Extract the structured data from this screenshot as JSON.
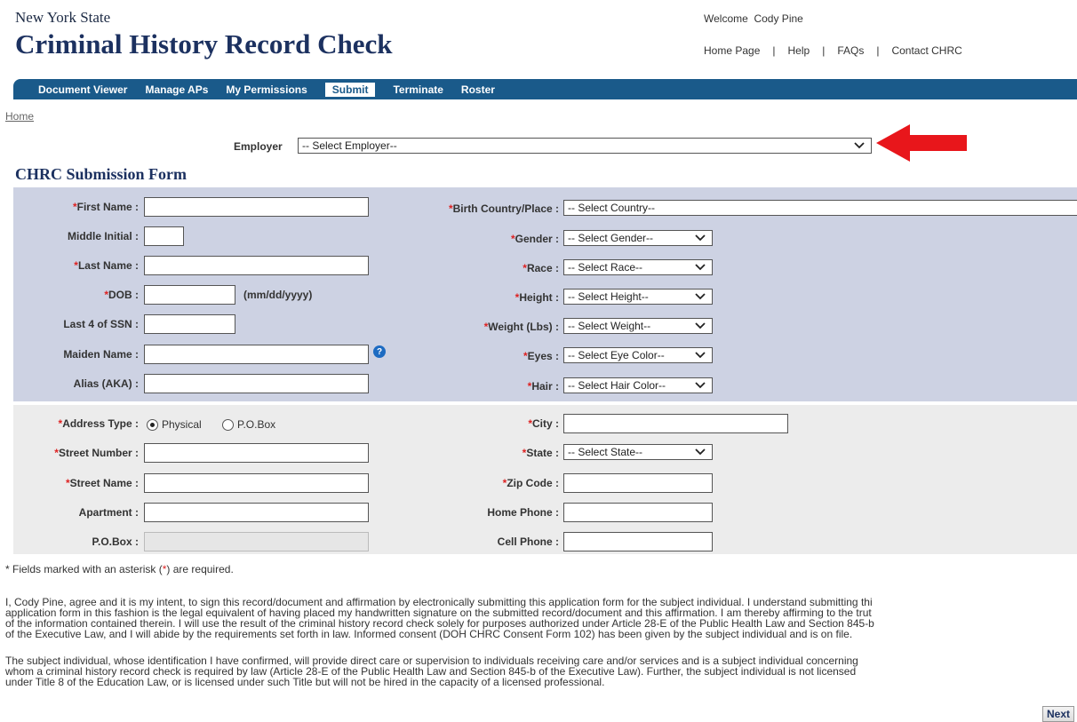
{
  "header": {
    "subtitle": "New York State",
    "title": "Criminal History Record Check",
    "welcome": "Welcome  Cody Pine",
    "links": [
      "Home Page",
      "Help",
      "FAQs",
      "Contact CHRC"
    ]
  },
  "nav": {
    "items": [
      {
        "label": "Document Viewer",
        "active": false
      },
      {
        "label": "Manage APs",
        "active": false
      },
      {
        "label": "My Permissions",
        "active": false
      },
      {
        "label": "Submit",
        "active": true
      },
      {
        "label": "Terminate",
        "active": false
      },
      {
        "label": "Roster",
        "active": false
      }
    ]
  },
  "breadcrumb": "Home",
  "employer": {
    "label": "Employer",
    "value": "-- Select Employer--"
  },
  "form_title": "CHRC Submission Form",
  "personal": {
    "first_name": "First Name :",
    "middle_initial": "Middle Initial :",
    "last_name": "Last Name :",
    "dob": "DOB :",
    "dob_hint": "(mm/dd/yyyy)",
    "ssn": "Last 4 of SSN :",
    "maiden": "Maiden Name :",
    "alias": "Alias (AKA) :",
    "birth_country": "Birth Country/Place :",
    "birth_country_value": "-- Select Country--",
    "gender": "Gender :",
    "gender_value": "-- Select Gender--",
    "race": "Race :",
    "race_value": "-- Select Race--",
    "height": "Height :",
    "height_value": "-- Select Height--",
    "weight": "Weight (Lbs) :",
    "weight_value": "-- Select Weight--",
    "eyes": "Eyes :",
    "eyes_value": "-- Select Eye Color--",
    "hair": "Hair :",
    "hair_value": "-- Select Hair Color--"
  },
  "address": {
    "type": "Address Type :",
    "physical": "Physical",
    "pobox_opt": "P.O.Box",
    "street_number": "Street Number :",
    "street_name": "Street Name :",
    "apartment": "Apartment :",
    "pobox": "P.O.Box :",
    "city": "City :",
    "state": "State :",
    "state_value": "-- Select State--",
    "zip": "Zip Code :",
    "home_phone": "Home Phone :",
    "cell_phone": "Cell Phone :"
  },
  "required_note_pre": "* Fields marked with an asterisk (",
  "required_note_star": "*",
  "required_note_post": ") are required.",
  "affirmation_lines": [
    "I, Cody Pine, agree and it is my intent, to sign this record/document and affirmation by electronically submitting this application form for the subject individual. I understand submitting thi",
    "application form in this fashion is the legal equivalent of having placed my handwritten signature on the submitted record/document and this affirmation. I am thereby affirming to the trut",
    "of the information contained therein. I will use the result of the criminal history record check solely for purposes authorized under Article 28-E of the Public Health Law and Section 845-b",
    "of the Executive Law, and I will abide by the requirements set forth in law. Informed consent (DOH CHRC Consent Form 102) has been given by the subject individual and is on file."
  ],
  "subject_lines": [
    "The subject individual, whose identification I have confirmed, will provide direct care or supervision to individuals receiving care and/or services and is a subject individual concerning",
    "whom a criminal history record check is required by law (Article 28-E of the Public Health Law and Section 845-b of the Executive Law). Further, the subject individual is not licensed",
    "under Title 8 of the Education Law, or is licensed under such Title but will not be hired in the capacity of a licensed professional."
  ],
  "next_label": "Next",
  "colors": {
    "nav": "#1a5a8a",
    "title": "#1c3160",
    "required": "#d22",
    "panel": "#cdd2e3",
    "pointer": "#e8161b"
  }
}
